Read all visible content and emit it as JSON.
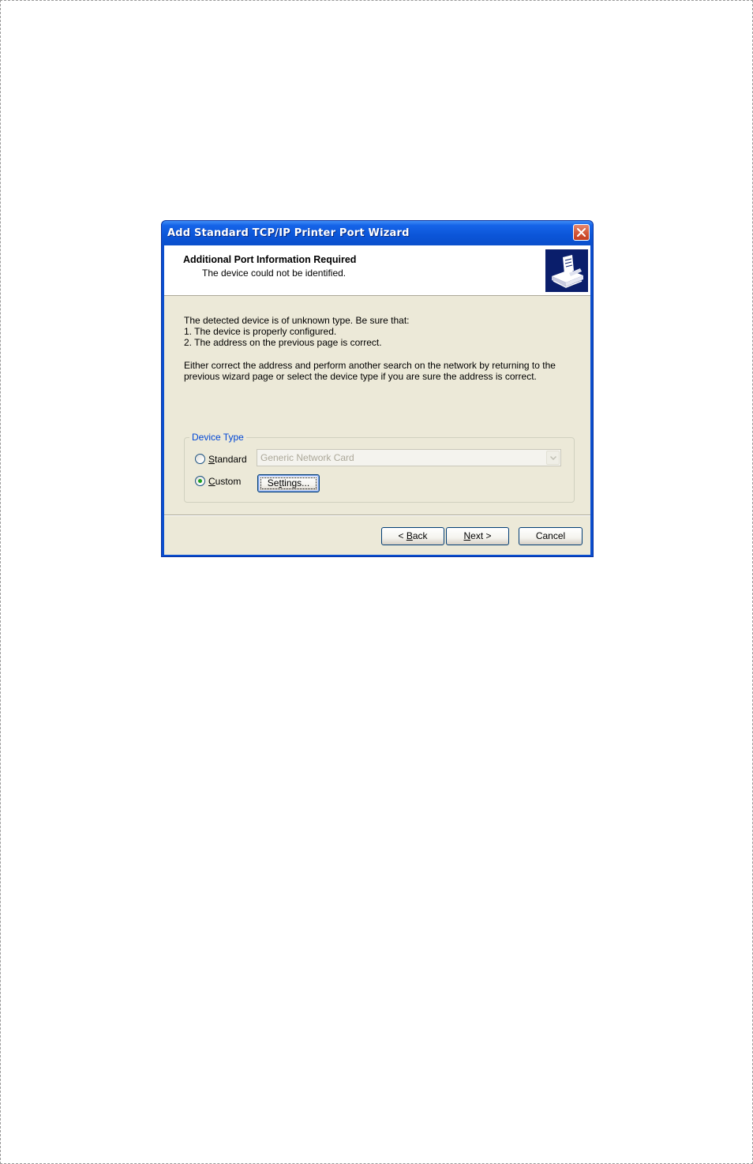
{
  "window": {
    "title": "Add Standard TCP/IP Printer Port Wizard"
  },
  "header": {
    "title": "Additional Port Information Required",
    "subtitle": "The device could not be identified.",
    "icon": "printer-network-icon"
  },
  "body": {
    "line1": "The detected device is of unknown type.  Be sure that:",
    "line2": "1. The device is properly configured.",
    "line3": "2.  The address on the previous page is correct.",
    "line4": "Either correct the address and perform another search on the network by returning to the",
    "line5": "previous wizard page or select the device type if you are sure the address is correct."
  },
  "device_type": {
    "legend": "Device Type",
    "standard": {
      "label_prefix": "",
      "label_accel": "S",
      "label_rest": "tandard",
      "selected": false
    },
    "custom": {
      "label_prefix": "",
      "label_accel": "C",
      "label_rest": "ustom",
      "selected": true
    },
    "combo_value": "Generic Network Card",
    "settings": {
      "prefix": "Se",
      "accel": "t",
      "rest": "tings..."
    }
  },
  "footer": {
    "back": {
      "prefix": "< ",
      "accel": "B",
      "rest": "ack"
    },
    "next": {
      "prefix": "",
      "accel": "N",
      "rest": "ext >"
    },
    "cancel": "Cancel"
  },
  "colors": {
    "titlebar": "#0b55d8",
    "client": "#ece9d8",
    "legend": "#0046d5",
    "radio_dot": "#21a121"
  }
}
